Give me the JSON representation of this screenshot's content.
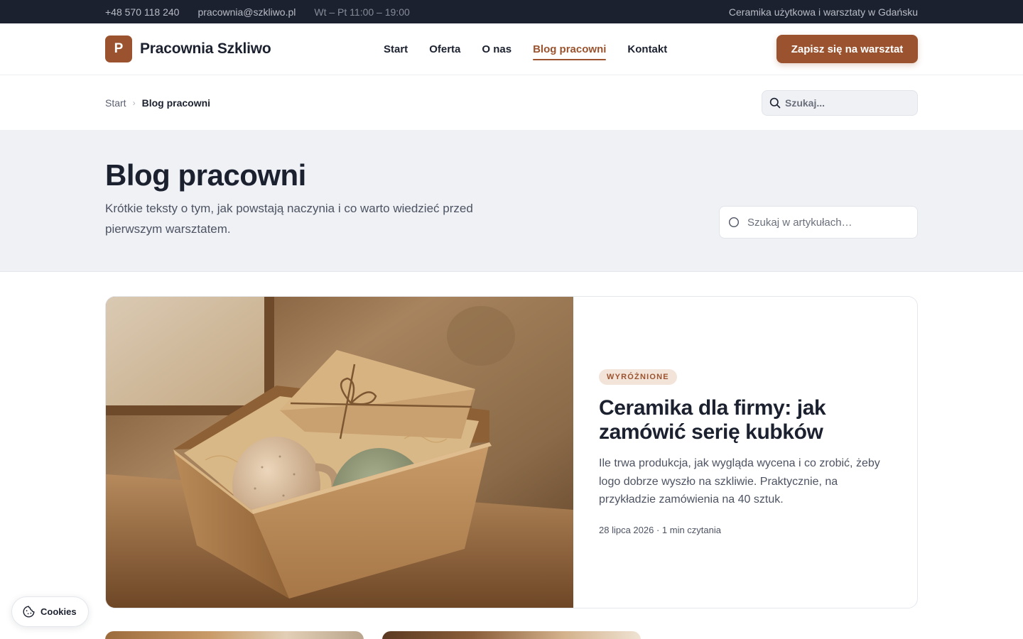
{
  "topbar": {
    "phone": "+48 570 118 240",
    "email": "pracownia@szkliwo.pl",
    "hours": "Wt – Pt 11:00 – 19:00",
    "tagline": "Ceramika użytkowa i warsztaty w Gdańsku"
  },
  "header": {
    "logo_letter": "P",
    "brand": "Pracownia Szkliwo",
    "nav": [
      {
        "label": "Start"
      },
      {
        "label": "Oferta"
      },
      {
        "label": "O nas"
      },
      {
        "label": "Blog pracowni",
        "active": true
      },
      {
        "label": "Kontakt"
      }
    ],
    "cta": "Zapisz się na warsztat"
  },
  "breadcrumb": {
    "start": "Start",
    "separator": "›",
    "current": "Blog pracowni"
  },
  "top_search": {
    "placeholder": "Szukaj..."
  },
  "hero": {
    "title": "Blog pracowni",
    "subtitle": "Krótkie teksty o tym, jak powstają naczynia i co warto wiedzieć przed pierwszym warsztatem.",
    "search_placeholder": "Szukaj w artykułach…"
  },
  "featured": {
    "badge": "WYRÓŻNIONE",
    "title": "Ceramika dla firmy: jak zamówić serię kubków",
    "excerpt": "Ile trwa produkcja, jak wygląda wycena i co zrobić, żeby logo dobrze wyszło na szkliwie. Praktycznie, na przykładzie zamówienia na 40 sztuk.",
    "meta": "28 lipca 2026 · 1 min czytania",
    "image_icon": "gift-box-mugs-photo"
  },
  "cookies": {
    "label": "Cookies",
    "icon": "cookie-icon"
  },
  "colors": {
    "accent": "#9a532e",
    "dark": "#1c2130",
    "hero_bg": "#eff1f5",
    "badge_bg": "#f3e4da"
  }
}
